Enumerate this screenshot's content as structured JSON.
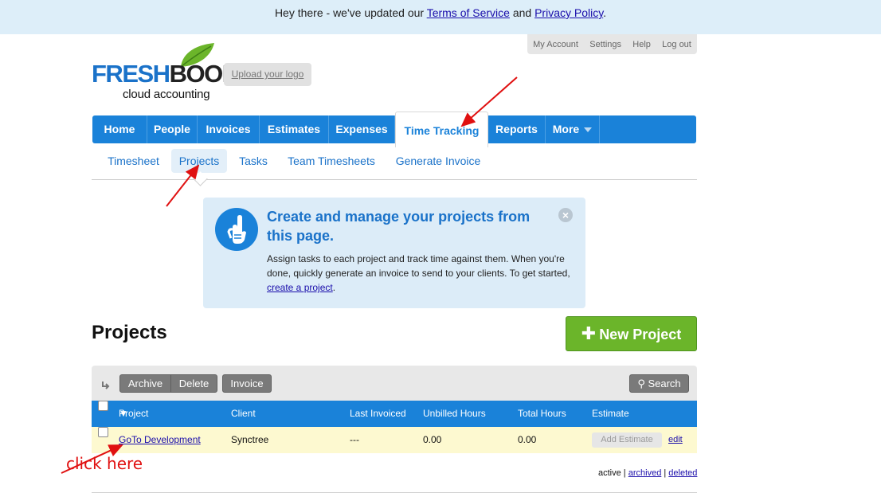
{
  "banner": {
    "prefix": "Hey there - we've updated our ",
    "tos_link": "Terms of Service",
    "middle": " and ",
    "privacy_link": "Privacy Policy",
    "suffix": "."
  },
  "account_links": [
    "My Account",
    "Settings",
    "Help",
    "Log out"
  ],
  "logo": {
    "brand_fresh": "FRESH",
    "brand_books": "BOOKS",
    "tagline": "cloud accounting"
  },
  "upload_logo": "Upload your logo",
  "main_nav": {
    "items": [
      "Home",
      "People",
      "Invoices",
      "Estimates",
      "Expenses",
      "Time Tracking",
      "Reports",
      "More"
    ],
    "active": "Time Tracking"
  },
  "sub_nav": {
    "items": [
      "Timesheet",
      "Projects",
      "Tasks",
      "Team Timesheets",
      "Generate Invoice"
    ],
    "active": "Projects"
  },
  "info_box": {
    "title": "Create and manage your projects from this page.",
    "body": "Assign tasks to each project and track time against them. When you're done, quickly generate an invoice to send to your clients. To get started, ",
    "link": "create a project",
    "body_end": "."
  },
  "page_title": "Projects",
  "new_project_button": "New Project",
  "toolbar": {
    "archive": "Archive",
    "delete": "Delete",
    "invoice": "Invoice",
    "search": "Search"
  },
  "table": {
    "columns": [
      "Project Name",
      "Client",
      "Last Invoiced",
      "Unbilled Hours",
      "Total Hours",
      "Estimate"
    ],
    "rows": [
      {
        "project_name": "GoTo Development",
        "client": "Synctree",
        "last_invoiced": "---",
        "unbilled_hours": "0.00",
        "total_hours": "0.00",
        "estimate_button": "Add Estimate",
        "edit": "edit"
      }
    ]
  },
  "status_filter": {
    "active": "active",
    "sep1": " | ",
    "archived": "archived",
    "sep2": " | ",
    "deleted": "deleted"
  },
  "annotation": {
    "click_here": "click here",
    "color": "#e01010"
  },
  "colors": {
    "brand_blue": "#1a82d9",
    "banner_bg": "#ddeef9",
    "new_project_green": "#6bb52a",
    "row_highlight": "#fdf9d0"
  }
}
